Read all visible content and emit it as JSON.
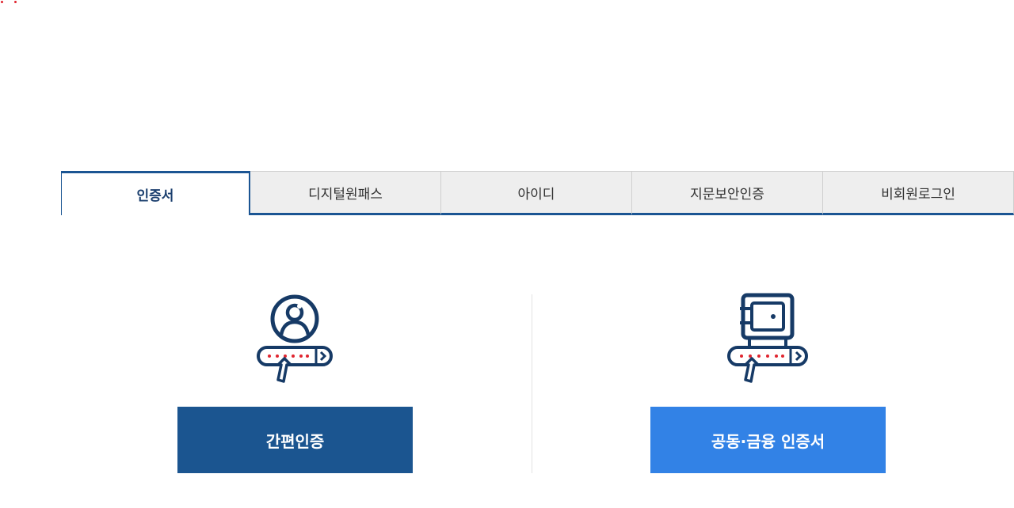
{
  "tabs": [
    {
      "label": "인증서",
      "active": true
    },
    {
      "label": "디지털원패스",
      "active": false
    },
    {
      "label": "아이디",
      "active": false
    },
    {
      "label": "지문보안인증",
      "active": false
    },
    {
      "label": "비회원로그인",
      "active": false
    }
  ],
  "options": {
    "simple_auth": {
      "label": "간편인증",
      "icon": "user-password-icon"
    },
    "joint_cert": {
      "label": "공동·금융 인증서",
      "icon": "safe-password-icon"
    }
  },
  "colors": {
    "primary_navy": "#1b5590",
    "accent_blue": "#3282e6",
    "icon_navy": "#163a66",
    "password_dot_red": "#e0252f"
  }
}
